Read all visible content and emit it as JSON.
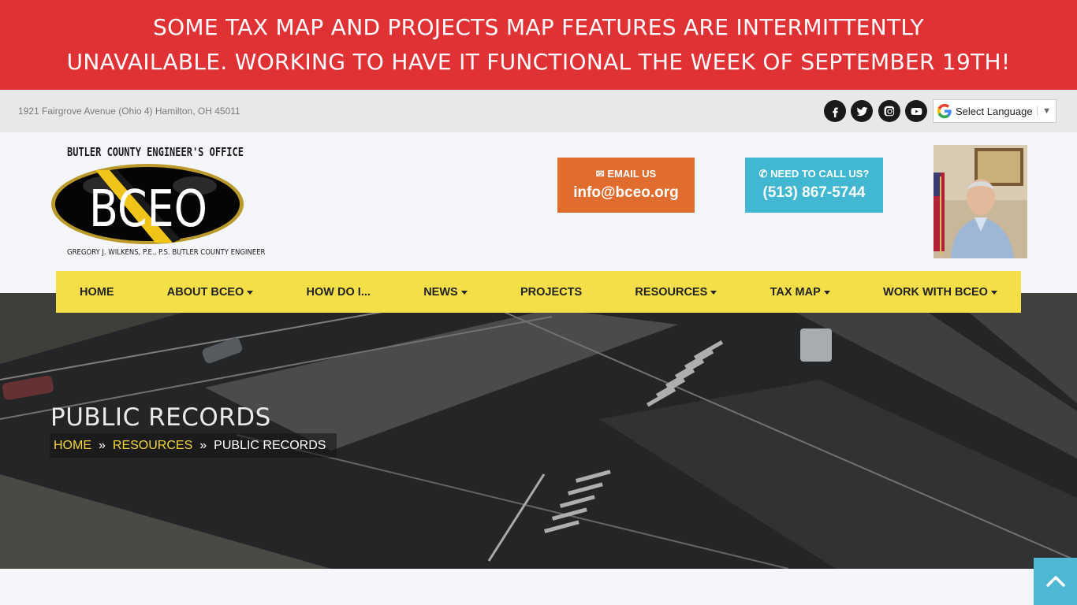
{
  "alert": {
    "line1": "SOME TAX MAP AND PROJECTS MAP FEATURES ARE INTERMITTENTLY",
    "line2": "UNAVAILABLE. WORKING TO HAVE IT FUNCTIONAL THE WEEK OF SEPTEMBER 19TH!"
  },
  "topbar": {
    "address": "1921 Fairgrove Avenue (Ohio 4) Hamilton, OH 45011",
    "social_icons": [
      "facebook-icon",
      "twitter-icon",
      "instagram-icon",
      "youtube-icon"
    ],
    "language_select": "Select Language"
  },
  "logo": {
    "top_text": "BUTLER COUNTY ENGINEER'S OFFICE",
    "main_text": "BCEO",
    "bottom_text": "GREGORY J. WILKENS, P.E., P.S. BUTLER COUNTY ENGINEER"
  },
  "cta": {
    "email_label": "EMAIL US",
    "email_value": "info@bceo.org",
    "call_label": "NEED TO CALL US?",
    "call_value": "(513) 867-5744"
  },
  "nav": {
    "items": [
      {
        "label": "HOME"
      },
      {
        "label": "ABOUT BCEO"
      },
      {
        "label": "HOW DO I..."
      },
      {
        "label": "NEWS"
      },
      {
        "label": "PROJECTS"
      },
      {
        "label": "RESOURCES"
      },
      {
        "label": "TAX MAP"
      },
      {
        "label": "WORK WITH BCEO"
      }
    ]
  },
  "hero": {
    "title": "PUBLIC RECORDS",
    "breadcrumb": [
      "HOME",
      "RESOURCES",
      "PUBLIC RECORDS"
    ],
    "separator": "»"
  },
  "colors": {
    "alert_bg": "#e03134",
    "email_bg": "#e06c2e",
    "call_bg": "#42b7d2",
    "nav_bg": "#f4df48",
    "breadcrumb_link": "#f4d83a"
  }
}
